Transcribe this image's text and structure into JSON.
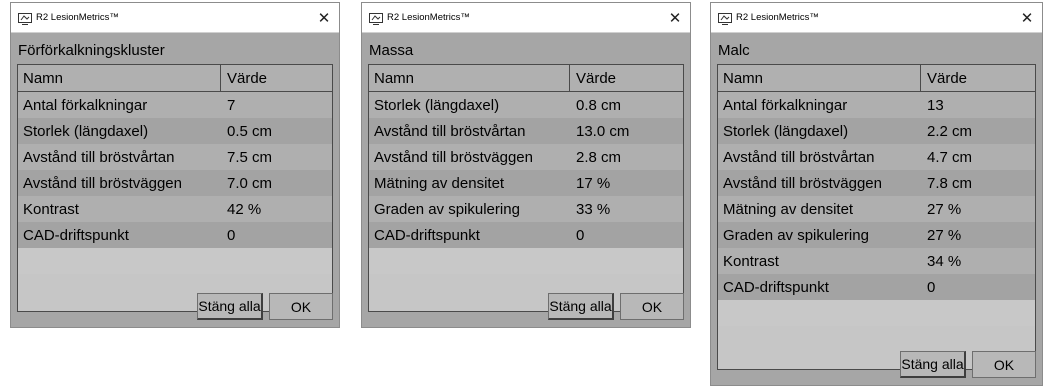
{
  "windows": [
    {
      "app_title": "R2 LesionMetrics™",
      "section": "Förförkalkningskluster",
      "columns": [
        "Namn",
        "Värde"
      ],
      "rows": [
        {
          "name": "Antal förkalkningar",
          "value": "7"
        },
        {
          "name": "Storlek (längdaxel)",
          "value": "0.5 cm"
        },
        {
          "name": "Avstånd till bröstvårtan",
          "value": "7.5 cm"
        },
        {
          "name": "Avstånd till bröstväggen",
          "value": "7.0 cm"
        },
        {
          "name": "Kontrast",
          "value": "42 %"
        },
        {
          "name": "CAD-driftspunkt",
          "value": "0"
        }
      ],
      "close_all_label": "Stäng alla",
      "ok_label": "OK"
    },
    {
      "app_title": "R2 LesionMetrics™",
      "section": "Massa",
      "columns": [
        "Namn",
        "Värde"
      ],
      "rows": [
        {
          "name": "Storlek (längdaxel)",
          "value": "0.8 cm"
        },
        {
          "name": "Avstånd till bröstvårtan",
          "value": "13.0 cm"
        },
        {
          "name": "Avstånd till bröstväggen",
          "value": "2.8 cm"
        },
        {
          "name": "Mätning av densitet",
          "value": "17 %"
        },
        {
          "name": "Graden av spikulering",
          "value": "33 %"
        },
        {
          "name": "CAD-driftspunkt",
          "value": "0"
        }
      ],
      "close_all_label": "Stäng alla",
      "ok_label": "OK"
    },
    {
      "app_title": "R2 LesionMetrics™",
      "section": "Malc",
      "columns": [
        "Namn",
        "Värde"
      ],
      "rows": [
        {
          "name": "Antal förkalkningar",
          "value": "13"
        },
        {
          "name": "Storlek (längdaxel)",
          "value": "2.2 cm"
        },
        {
          "name": "Avstånd till bröstvårtan",
          "value": "4.7 cm"
        },
        {
          "name": "Avstånd till bröstväggen",
          "value": "7.8 cm"
        },
        {
          "name": "Mätning av densitet",
          "value": "27 %"
        },
        {
          "name": "Graden av spikulering",
          "value": "27 %"
        },
        {
          "name": "Kontrast",
          "value": "34 %"
        },
        {
          "name": "CAD-driftspunkt",
          "value": "0"
        }
      ],
      "close_all_label": "Stäng alla",
      "ok_label": "OK"
    }
  ],
  "icons": {
    "app_icon": "monitor-lesion-icon",
    "close": "close-icon"
  },
  "colors": {
    "dialog_bg": "#a6a6a6",
    "titlebar_bg": "#ffffff",
    "table_border": "#4a4a4a"
  }
}
